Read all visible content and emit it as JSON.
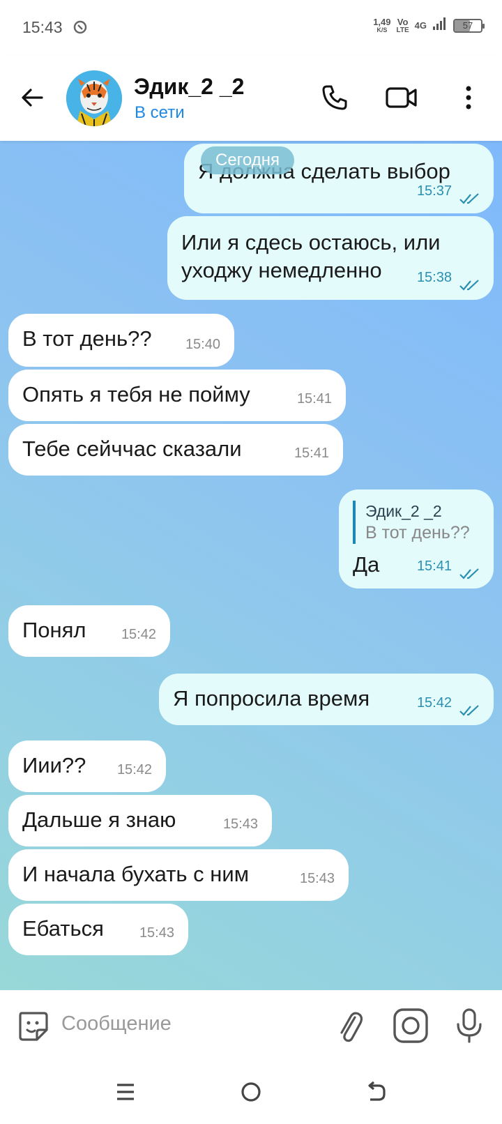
{
  "status_bar": {
    "time": "15:43",
    "net_speed_value": "1,49",
    "net_speed_unit": "K/S",
    "volte_top": "Vo",
    "volte_bottom": "LTE",
    "network": "4G",
    "battery": "57",
    "battery_level": 0.57
  },
  "header": {
    "contact_name": "Эдик_2 _2",
    "contact_status": "В сети"
  },
  "chat": {
    "date_chip": "Сегодня",
    "messages": [
      {
        "dir": "out",
        "text": "Я должна сделать выбор",
        "time": "15:37",
        "read": true
      },
      {
        "dir": "out",
        "text": "Или я сдесь остаюсь, или уходжу немедленно",
        "time": "15:38",
        "read": true
      },
      {
        "dir": "in",
        "text": "В тот день??",
        "time": "15:40"
      },
      {
        "dir": "in",
        "text": "Опять я тебя не пойму",
        "time": "15:41"
      },
      {
        "dir": "in",
        "text": "Тебе сейччас сказали",
        "time": "15:41"
      },
      {
        "dir": "out",
        "reply_author": "Эдик_2 _2",
        "reply_text": "В тот день??",
        "text": "Да",
        "time": "15:41",
        "read": true
      },
      {
        "dir": "in",
        "text": "Понял",
        "time": "15:42"
      },
      {
        "dir": "out",
        "text": "Я попросила время",
        "time": "15:42",
        "read": true
      },
      {
        "dir": "in",
        "text": "Иии??",
        "time": "15:42"
      },
      {
        "dir": "in",
        "text": "Дальше я знаю",
        "time": "15:43"
      },
      {
        "dir": "in",
        "text": "И начала бухать с ним",
        "time": "15:43"
      },
      {
        "dir": "in",
        "text": "Ебаться",
        "time": "15:43"
      }
    ]
  },
  "input": {
    "placeholder": "Сообщение"
  },
  "colors": {
    "accent": "#1e88e5",
    "outgoing_bubble": "#e4fbfb",
    "incoming_bubble": "#ffffff"
  }
}
